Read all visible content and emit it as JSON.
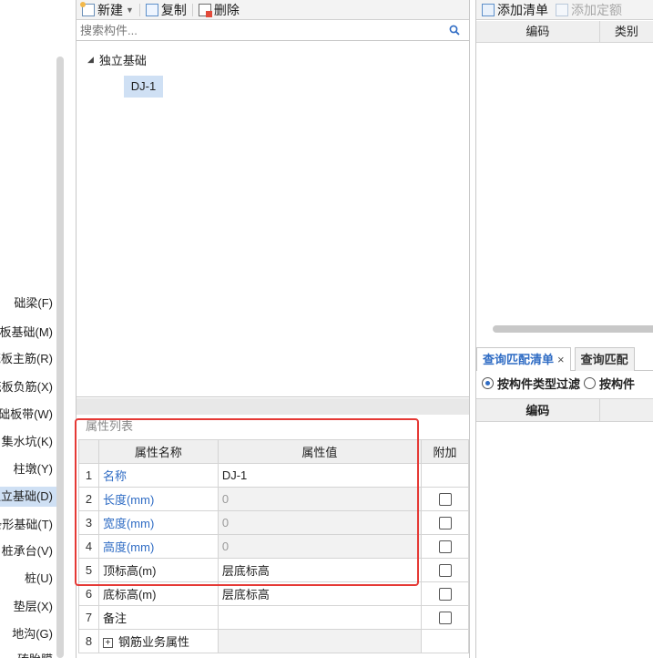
{
  "nav": {
    "items": [
      {
        "label": "础梁(F)",
        "selected": false
      },
      {
        "label": "筏板基础(M)",
        "selected": false
      },
      {
        "label": "筏板主筋(R)",
        "selected": false
      },
      {
        "label": "筏板负筋(X)",
        "selected": false
      },
      {
        "label": "基础板带(W)",
        "selected": false
      },
      {
        "label": "集水坑(K)",
        "selected": false
      },
      {
        "label": "柱墩(Y)",
        "selected": false
      },
      {
        "label": "独立基础(D)",
        "selected": true
      },
      {
        "label": "条形基础(T)",
        "selected": false
      },
      {
        "label": "桩承台(V)",
        "selected": false
      },
      {
        "label": "桩(U)",
        "selected": false
      },
      {
        "label": "垫层(X)",
        "selected": false
      },
      {
        "label": "地沟(G)",
        "selected": false
      },
      {
        "label": "砖胎膜",
        "selected": false
      }
    ]
  },
  "toolbar": {
    "new_label": "新建",
    "copy_label": "复制",
    "delete_label": "删除"
  },
  "search": {
    "placeholder": "搜索构件..."
  },
  "tree": {
    "root_label": "独立基础",
    "child_label": "DJ-1"
  },
  "props": {
    "title": "属性列表",
    "headers": {
      "name": "属性名称",
      "value": "属性值",
      "add": "附加"
    },
    "rows": [
      {
        "idx": "1",
        "name": "名称",
        "value": "DJ-1"
      },
      {
        "idx": "2",
        "name": "长度(mm)",
        "value": "0"
      },
      {
        "idx": "3",
        "name": "宽度(mm)",
        "value": "0"
      },
      {
        "idx": "4",
        "name": "高度(mm)",
        "value": "0"
      },
      {
        "idx": "5",
        "name": "顶标高(m)",
        "value": "层底标高"
      },
      {
        "idx": "6",
        "name": "底标高(m)",
        "value": "层底标高"
      },
      {
        "idx": "7",
        "name": "备注",
        "value": ""
      },
      {
        "idx": "8",
        "name": "钢筋业务属性",
        "value": ""
      }
    ]
  },
  "right": {
    "toolbar": {
      "add_list_label": "添加清单",
      "add_quota_label": "添加定额"
    },
    "header": {
      "code": "编码",
      "category": "类别"
    },
    "tabs": {
      "active": "查询匹配清单",
      "close": "×",
      "inactive": "查询匹配"
    },
    "radio": {
      "option1": "按构件类型过滤",
      "option2": "按构件"
    },
    "header2": {
      "code": "编码"
    }
  }
}
